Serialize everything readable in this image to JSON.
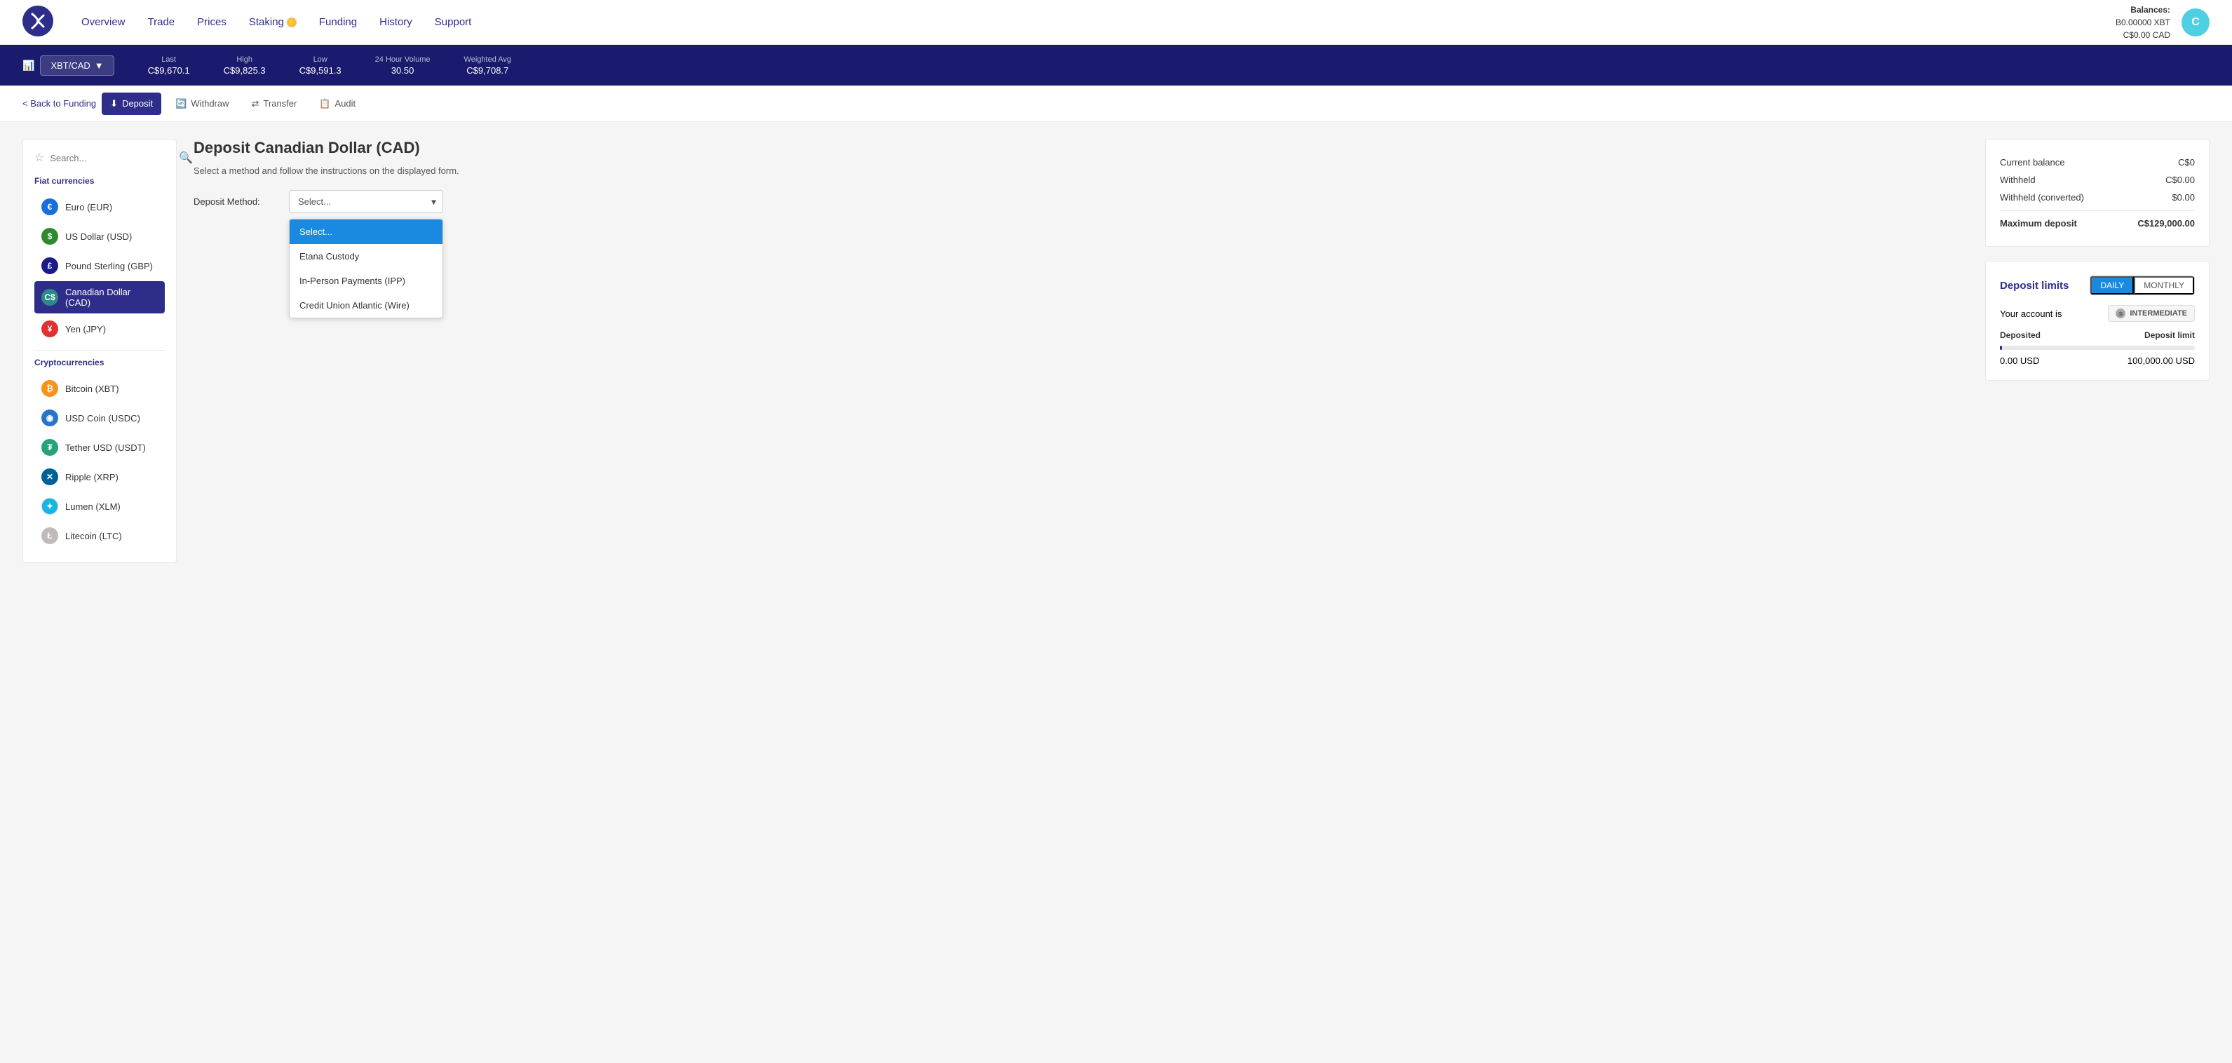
{
  "header": {
    "logo_alt": "Kraken Logo",
    "nav_items": [
      {
        "label": "Overview",
        "id": "overview"
      },
      {
        "label": "Trade",
        "id": "trade"
      },
      {
        "label": "Prices",
        "id": "prices"
      },
      {
        "label": "Staking",
        "id": "staking"
      },
      {
        "label": "Funding",
        "id": "funding"
      },
      {
        "label": "History",
        "id": "history"
      },
      {
        "label": "Support",
        "id": "support"
      }
    ],
    "balances_label": "Balances:",
    "balance_xbt": "B0.00000 XBT",
    "balance_cad": "C$0.00 CAD",
    "avatar_letter": "C"
  },
  "ticker": {
    "pair": "XBT/CAD",
    "stats": [
      {
        "label": "Last",
        "value": "C$9,670.1"
      },
      {
        "label": "High",
        "value": "C$9,825.3"
      },
      {
        "label": "Low",
        "value": "C$9,591.3"
      },
      {
        "label": "24 Hour Volume",
        "value": "30.50"
      },
      {
        "label": "Weighted Avg",
        "value": "C$9,708.7"
      }
    ]
  },
  "sub_nav": {
    "back_label": "< Back to Funding",
    "deposit_label": "Deposit",
    "withdraw_label": "Withdraw",
    "transfer_label": "Transfer",
    "audit_label": "Audit"
  },
  "sidebar": {
    "search_placeholder": "Search...",
    "fiat_section": "Fiat currencies",
    "fiat_items": [
      {
        "label": "Euro (EUR)",
        "icon": "€",
        "icon_class": "icon-eur"
      },
      {
        "label": "US Dollar (USD)",
        "icon": "$",
        "icon_class": "icon-usd"
      },
      {
        "label": "Pound Sterling (GBP)",
        "icon": "£",
        "icon_class": "icon-gbp"
      },
      {
        "label": "Canadian Dollar (CAD)",
        "icon": "C$",
        "icon_class": "icon-cad",
        "active": true
      },
      {
        "label": "Yen (JPY)",
        "icon": "¥",
        "icon_class": "icon-jpy"
      }
    ],
    "crypto_section": "Cryptocurrencies",
    "crypto_items": [
      {
        "label": "Bitcoin (XBT)",
        "icon": "₿",
        "icon_class": "icon-btc"
      },
      {
        "label": "USD Coin (USDC)",
        "icon": "◉",
        "icon_class": "icon-usdc"
      },
      {
        "label": "Tether USD (USDT)",
        "icon": "₮",
        "icon_class": "icon-usdt"
      },
      {
        "label": "Ripple (XRP)",
        "icon": "✕",
        "icon_class": "icon-xrp"
      },
      {
        "label": "Lumen (XLM)",
        "icon": "✦",
        "icon_class": "icon-xlm"
      },
      {
        "label": "Litecoin (LTC)",
        "icon": "Ł",
        "icon_class": "icon-ltc"
      }
    ]
  },
  "deposit_form": {
    "title": "Deposit Canadian Dollar (CAD)",
    "subtitle": "Select a method and follow the instructions on the displayed form.",
    "method_label": "Deposit Method:",
    "select_placeholder": "Select...",
    "dropdown_items": [
      {
        "label": "Select...",
        "selected": true
      },
      {
        "label": "Etana Custody"
      },
      {
        "label": "In-Person Payments (IPP)"
      },
      {
        "label": "Credit Union Atlantic (Wire)"
      }
    ]
  },
  "balance_card": {
    "rows": [
      {
        "label": "Current balance",
        "value": "C$0"
      },
      {
        "label": "Withheld",
        "value": "C$0.00"
      },
      {
        "label": "Withheld (converted)",
        "value": "$0.00"
      },
      {
        "label": "Maximum deposit",
        "value": "C$129,000.00",
        "bold": true
      }
    ]
  },
  "limits_card": {
    "title": "Deposit limits",
    "tab_daily": "DAILY",
    "tab_monthly": "MONTHLY",
    "account_label": "Your account is",
    "account_level": "INTERMEDIATE",
    "col_deposited": "Deposited",
    "col_limit": "Deposit limit",
    "deposited_value": "0.00  USD",
    "limit_value": "100,000.00  USD",
    "progress_pct": 1
  }
}
